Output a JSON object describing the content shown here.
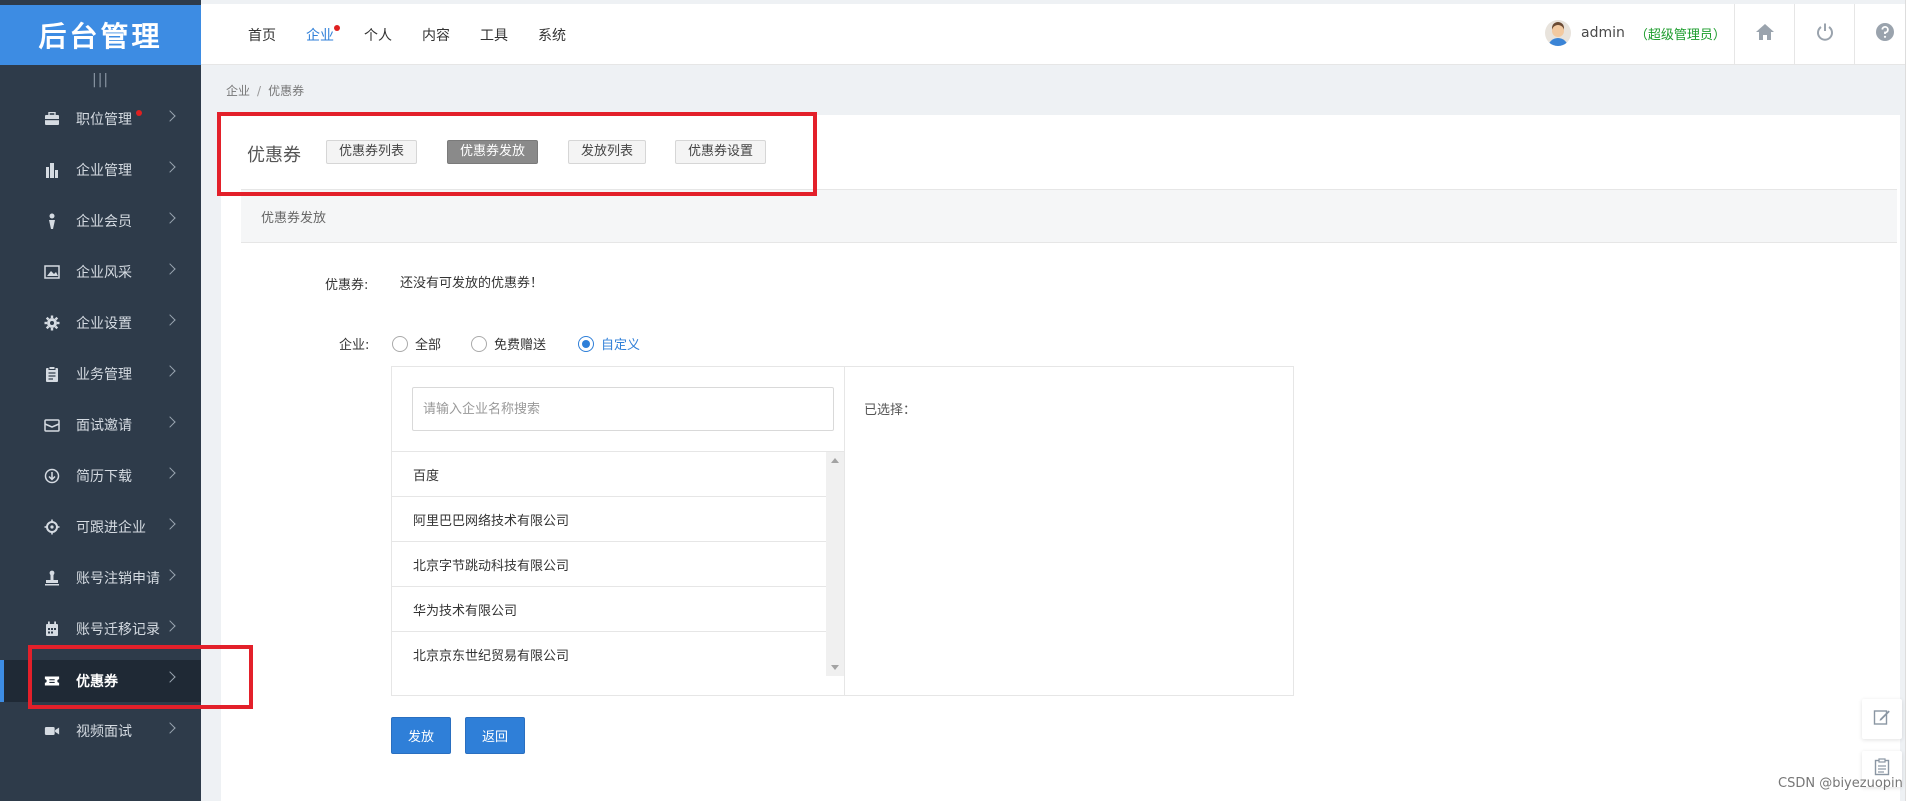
{
  "logo": "后台管理",
  "top_nav": [
    {
      "label": "首页"
    },
    {
      "label": "企业"
    },
    {
      "label": "个人"
    },
    {
      "label": "内容"
    },
    {
      "label": "工具"
    },
    {
      "label": "系统"
    }
  ],
  "user": {
    "name": "admin",
    "role": "（超级管理员）"
  },
  "sidebar": {
    "collapse_icon": "|||",
    "items": [
      {
        "label": "职位管理",
        "icon": "briefcase-icon"
      },
      {
        "label": "企业管理",
        "icon": "building-icon"
      },
      {
        "label": "企业会员",
        "icon": "member-icon"
      },
      {
        "label": "企业风采",
        "icon": "image-icon"
      },
      {
        "label": "企业设置",
        "icon": "gear-icon"
      },
      {
        "label": "业务管理",
        "icon": "clipboard-icon"
      },
      {
        "label": "面试邀请",
        "icon": "envelope-icon"
      },
      {
        "label": "简历下载",
        "icon": "download-icon"
      },
      {
        "label": "可跟进企业",
        "icon": "target-icon"
      },
      {
        "label": "账号注销申请",
        "icon": "stamp-icon"
      },
      {
        "label": "账号迁移记录",
        "icon": "calendar-icon"
      },
      {
        "label": "优惠券",
        "icon": "ticket-icon"
      },
      {
        "label": "视频面试",
        "icon": "video-icon"
      }
    ]
  },
  "breadcrumb": {
    "parent": "企业",
    "separator": "/",
    "current": "优惠券"
  },
  "page": {
    "title": "优惠券",
    "tabs": [
      {
        "label": "优惠券列表"
      },
      {
        "label": "优惠券发放"
      },
      {
        "label": "发放列表"
      },
      {
        "label": "优惠券设置"
      }
    ],
    "section_title": "优惠券发放"
  },
  "form": {
    "coupon_label": "优惠券:",
    "coupon_value": "还没有可发放的优惠券！",
    "company_label": "企业:",
    "radio_options": [
      {
        "label": "全部"
      },
      {
        "label": "免费赠送"
      },
      {
        "label": "自定义"
      }
    ],
    "selected_option": "自定义",
    "search_placeholder": "请输入企业名称搜索",
    "companies": [
      "百度",
      "阿里巴巴网络技术有限公司",
      "北京字节跳动科技有限公司",
      "华为技术有限公司",
      "北京京东世纪贸易有限公司"
    ],
    "selected_label": "已选择：",
    "submit_label": "发放",
    "back_label": "返回"
  },
  "watermark": "CSDN @biyezuopin",
  "colors": {
    "sidebar": "#2e3b4a",
    "logo": "#3d8ce3",
    "primary": "#2f7fd8",
    "role": "#1c9c2c",
    "highlight": "#e3202a"
  }
}
